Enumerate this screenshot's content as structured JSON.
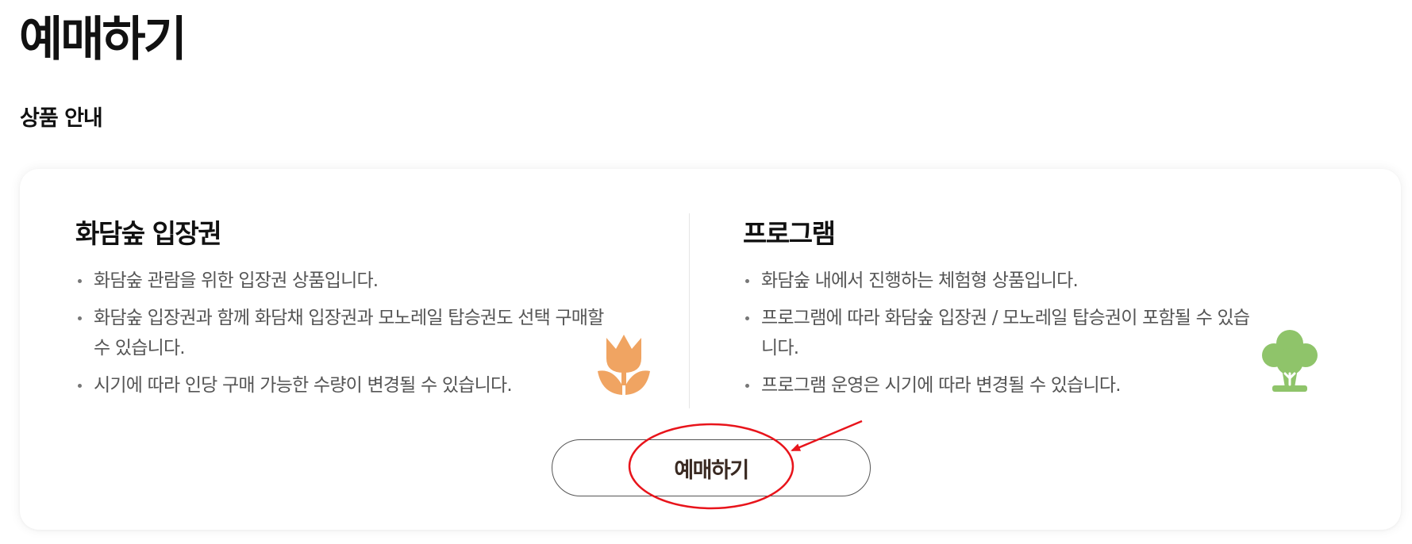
{
  "page": {
    "title": "예매하기"
  },
  "section": {
    "title": "상품 안내"
  },
  "products": [
    {
      "title": "화담숲 입장권",
      "bullets": [
        "화담숲 관람을 위한 입장권 상품입니다.",
        "화담숲 입장권과 함께 화담채 입장권과 모노레일 탑승권도 선택 구매할 수 있습니다.",
        "시기에 따라 인당 구매 가능한 수량이 변경될 수 있습니다."
      ],
      "icon": "tulip-icon"
    },
    {
      "title": "프로그램",
      "bullets": [
        "화담숲 내에서 진행하는 체험형 상품입니다.",
        "프로그램에 따라 화담숲 입장권 / 모노레일 탑승권이 포함될 수 있습니다.",
        "프로그램 운영은 시기에 따라 변경될 수 있습니다."
      ],
      "icon": "tree-icon"
    }
  ],
  "reserve_button": {
    "label": "예매하기"
  },
  "colors": {
    "tulip": "#f0a462",
    "tree": "#8fc46a",
    "annotation": "#e8141b",
    "button_border": "#555555"
  }
}
